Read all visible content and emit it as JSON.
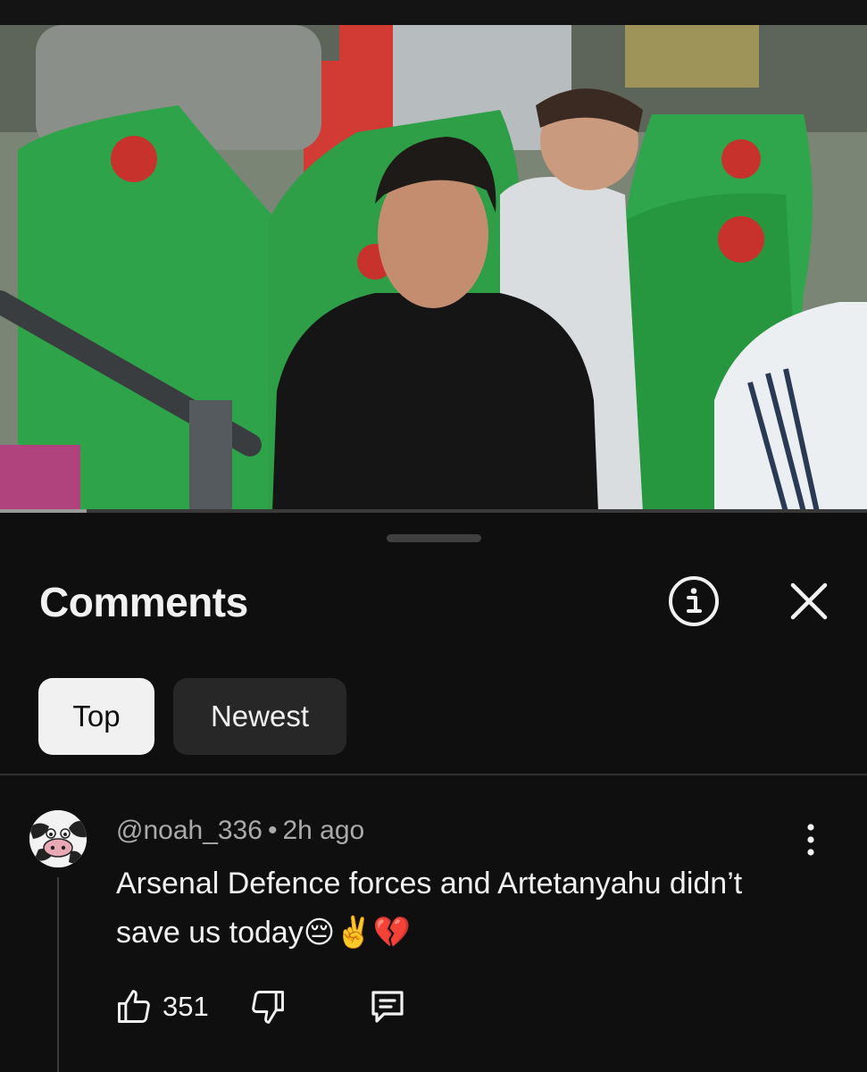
{
  "video": {
    "progress": 0.1
  },
  "sheet": {
    "title": "Comments",
    "icons": {
      "info": "info-circle-icon",
      "close": "close-x-icon"
    },
    "sort_chips": [
      {
        "label": "Top",
        "selected": true
      },
      {
        "label": "Newest",
        "selected": false
      }
    ]
  },
  "comment": {
    "author": "@noah_336",
    "separator": "•",
    "time": "2h ago",
    "text": "Arsenal Defence forces and Artetanyahu didn’t save us today😔✌️💔",
    "likes": "351",
    "icons": {
      "avatar": "cow-face-avatar",
      "more": "more-vertical-icon",
      "like": "thumbs-up-icon",
      "dislike": "thumbs-down-icon",
      "reply": "reply-comment-icon"
    }
  },
  "colors": {
    "background": "#0f0f0f",
    "chip_selected": "#f1f1f1",
    "chip_unselected": "#272727",
    "secondary_text": "#aaaaaa"
  }
}
